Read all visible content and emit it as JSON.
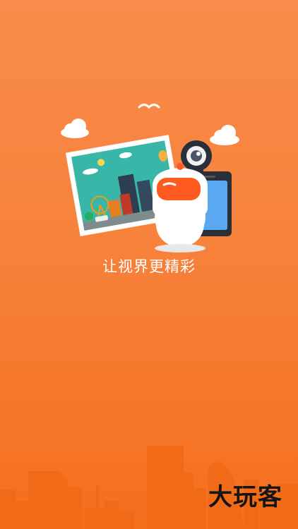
{
  "splash": {
    "tagline": "让视界更精彩",
    "brand": "大玩客"
  },
  "colors": {
    "background_top": "#f88c4a",
    "background_bottom": "#f56f1c",
    "skyline": "#f06a17",
    "mascot_visor": "#ff5a1f",
    "photo_sky": "#38b6a8",
    "phone_screen": "#5aa8f0"
  },
  "icons": [
    "bird-icon",
    "cloud-icon",
    "cloud-icon",
    "photo-frame-illustration",
    "webcam-icon",
    "phone-icon",
    "mascot-robot",
    "city-skyline"
  ]
}
